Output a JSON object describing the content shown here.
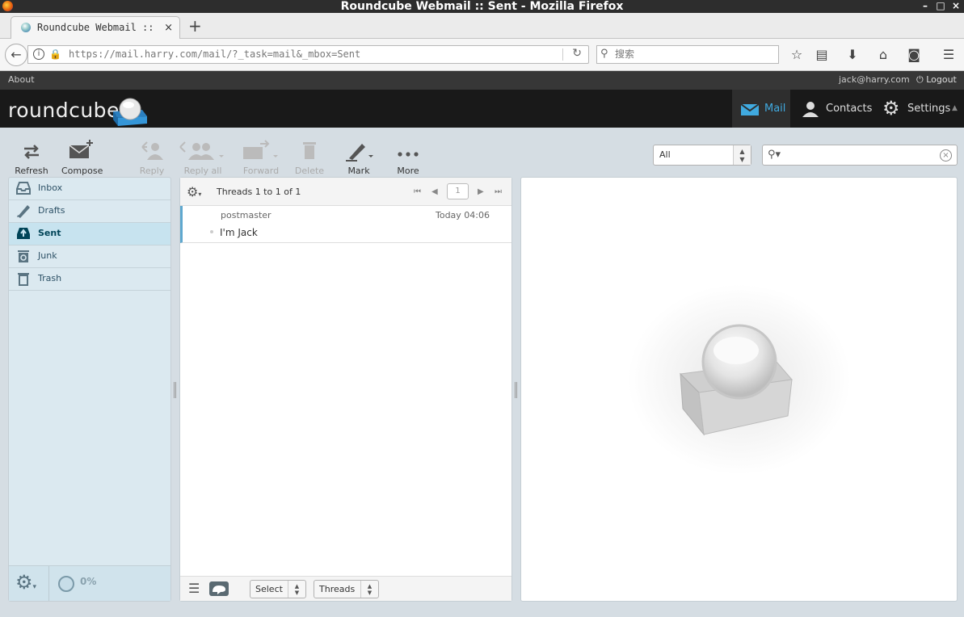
{
  "window": {
    "title": "Roundcube Webmail :: Sent - Mozilla Firefox",
    "controls": [
      "–",
      "□",
      "×"
    ]
  },
  "browser": {
    "tab_title": "Roundcube Webmail :: Sent",
    "tab_close": "×",
    "new_tab": "+",
    "url": "https://mail.harry.com/mail/?_task=mail&_mbox=Sent",
    "search_placeholder": "搜索",
    "icons": [
      "back-icon",
      "info-icon",
      "lock-icon",
      "reload-icon",
      "search-icon",
      "bookmark-star-icon",
      "reading-list-icon",
      "download-icon",
      "home-icon",
      "pocket-icon",
      "menu-icon"
    ]
  },
  "topline": {
    "about": "About",
    "user": "jack@harry.com",
    "logout": "Logout"
  },
  "header": {
    "logo": "roundcube",
    "nav": [
      {
        "label": "Mail",
        "icon": "mail-icon"
      },
      {
        "label": "Contacts",
        "icon": "contacts-icon"
      },
      {
        "label": "Settings",
        "icon": "settings-icon"
      }
    ]
  },
  "toolbar": {
    "refresh": "Refresh",
    "compose": "Compose",
    "reply": "Reply",
    "reply_all": "Reply all",
    "forward": "Forward",
    "delete": "Delete",
    "mark": "Mark",
    "more": "More"
  },
  "filter": {
    "selected": "All"
  },
  "folders": [
    {
      "label": "Inbox",
      "icon": "inbox-icon",
      "selected": false
    },
    {
      "label": "Drafts",
      "icon": "drafts-icon",
      "selected": false
    },
    {
      "label": "Sent",
      "icon": "sent-icon",
      "selected": true
    },
    {
      "label": "Junk",
      "icon": "junk-icon",
      "selected": false
    },
    {
      "label": "Trash",
      "icon": "trash-icon",
      "selected": false
    }
  ],
  "quota": "0%",
  "messagelist": {
    "count_label": "Threads 1 to 1 of 1",
    "page": "1",
    "messages": [
      {
        "from": "postmaster",
        "date": "Today 04:06",
        "subject": "I'm Jack"
      }
    ],
    "footer": {
      "select": "Select",
      "threads": "Threads"
    }
  },
  "colors": {
    "accent": "#40aae0",
    "header_bg": "#191919",
    "panel_bg": "#dbe9f0",
    "selected_folder": "#c7e3ef"
  }
}
